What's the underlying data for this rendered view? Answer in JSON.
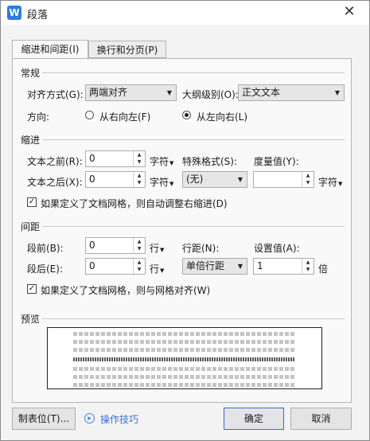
{
  "dialog": {
    "title": "段落",
    "app_icon": "wps-writer-icon",
    "close_glyph": "✕"
  },
  "tabs": [
    {
      "label": "缩进和间距(I)",
      "active": true
    },
    {
      "label": "换行和分页(P)",
      "active": false
    }
  ],
  "general": {
    "section_title": "常规",
    "alignment_label": "对齐方式(G):",
    "alignment_value": "两端对齐",
    "outline_label": "大纲级别(O):",
    "outline_value": "正文文本",
    "direction_label": "方向:",
    "direction_rtl": "从右向左(F)",
    "direction_ltr": "从左向右(L)",
    "selected_direction": "ltr"
  },
  "indent": {
    "section_title": "缩进",
    "before_label": "文本之前(R):",
    "before_value": "0",
    "before_unit": "字符",
    "after_label": "文本之后(X):",
    "after_value": "0",
    "after_unit": "字符",
    "special_label": "特殊格式(S):",
    "special_value": "(无)",
    "measure_label": "度量值(Y):",
    "measure_value": "",
    "measure_unit": "字符",
    "grid_checkbox_label": "如果定义了文档网格，则自动调整右缩进(D)",
    "grid_checked": true
  },
  "spacing": {
    "section_title": "间距",
    "before_label": "段前(B):",
    "before_value": "0",
    "before_unit": "行",
    "after_label": "段后(E):",
    "after_value": "0",
    "after_unit": "行",
    "line_label": "行距(N):",
    "line_value": "单倍行距",
    "setting_label": "设置值(A):",
    "setting_value": "1",
    "setting_unit": "倍",
    "grid_checkbox_label": "如果定义了文档网格，则与网格对齐(W)",
    "grid_checked": true
  },
  "preview": {
    "section_title": "预览"
  },
  "footer": {
    "tabs_button": "制表位(T)...",
    "tips_label": "操作技巧",
    "ok_button": "确定",
    "cancel_button": "取消"
  },
  "colors": {
    "accent": "#2c7be5",
    "link": "#3a6fd8"
  }
}
